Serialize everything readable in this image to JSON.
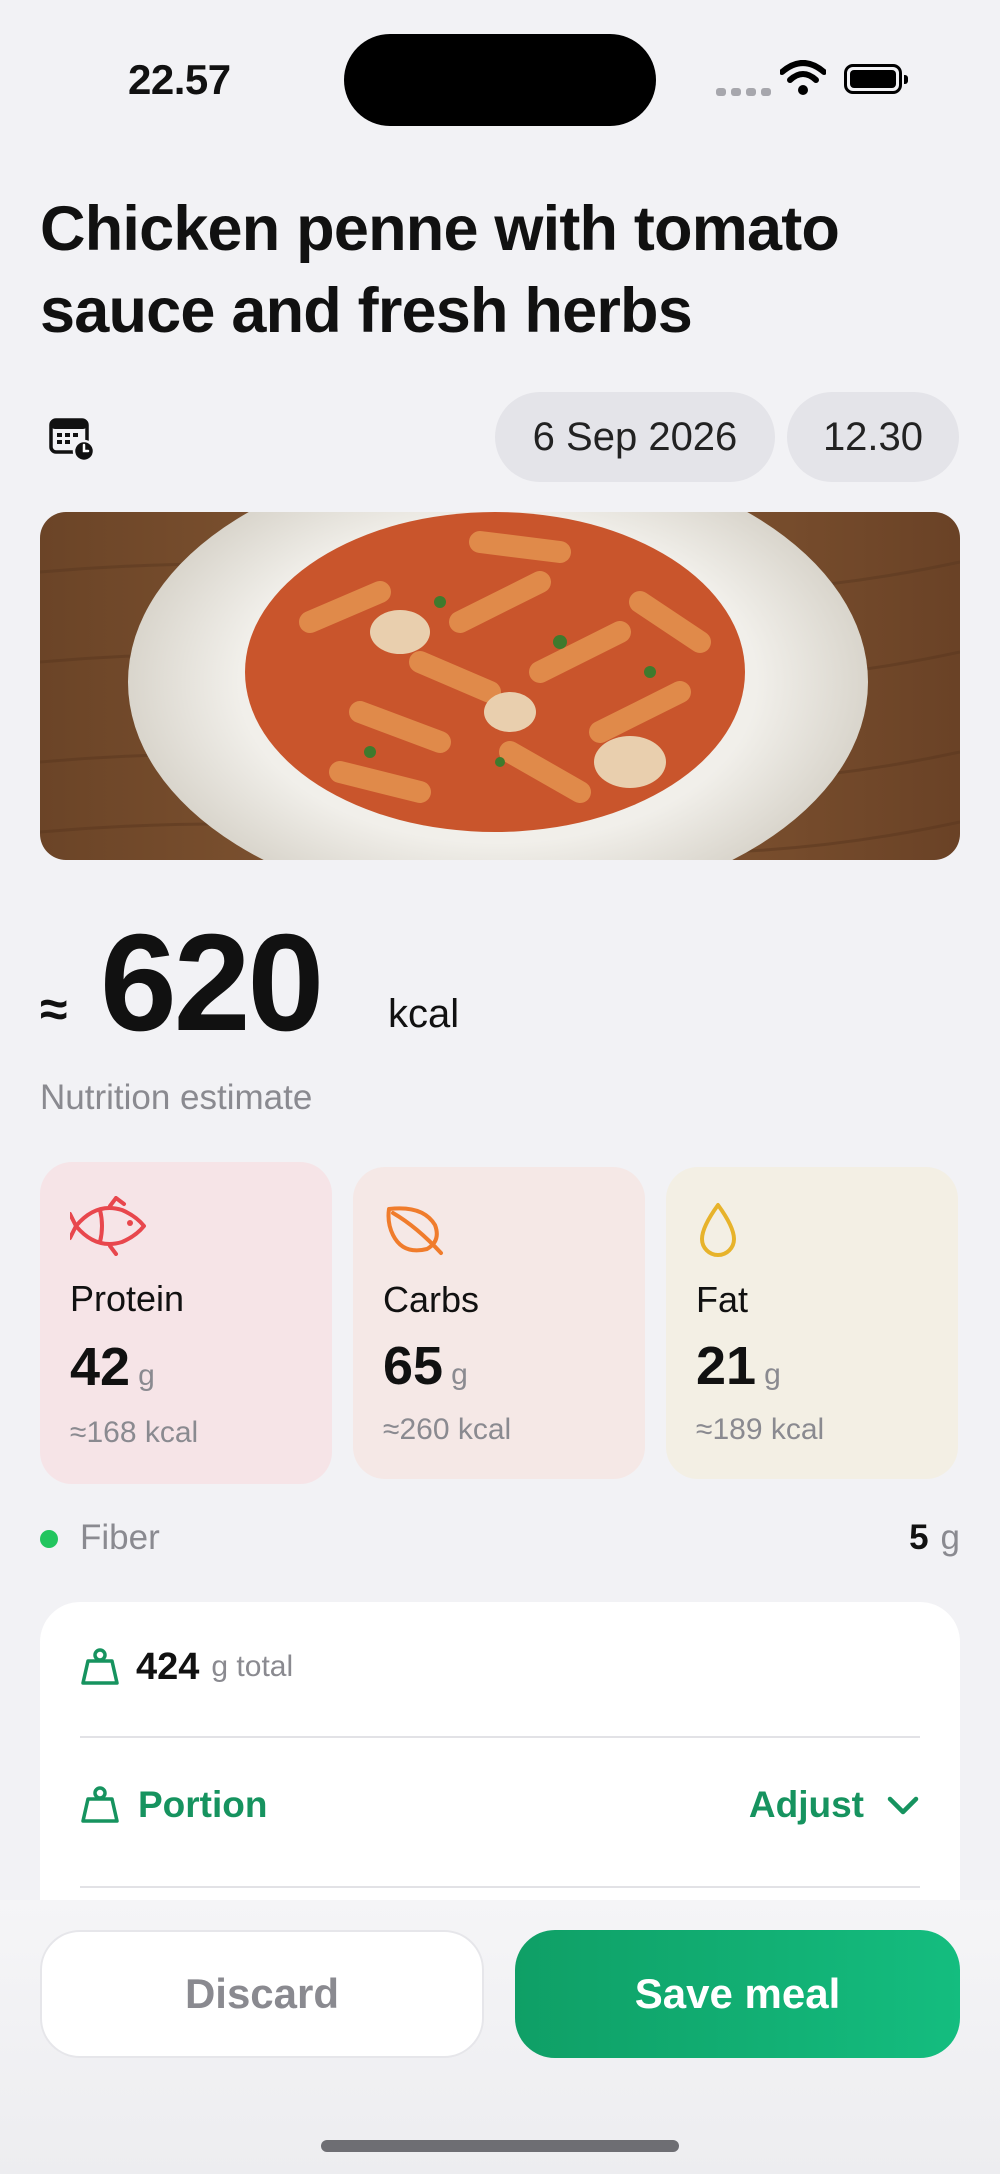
{
  "status_bar": {
    "time": "22.57"
  },
  "meal": {
    "title": "Chicken penne with tomato sauce and fresh herbs",
    "date": "6 Sep 2026",
    "time": "12.30",
    "calendar_icon": "calendar-clock-icon",
    "photo_description_icon": "meal-photo"
  },
  "energy": {
    "approx_symbol": "≈",
    "value": "620",
    "unit": "kcal",
    "label": "Nutrition estimate"
  },
  "macros": [
    {
      "name": "Protein",
      "value": "42",
      "unit": "g",
      "kcal": "≈168 kcal",
      "icon": "fish-icon",
      "color": "#e8474d"
    },
    {
      "name": "Carbs",
      "value": "65",
      "unit": "g",
      "kcal": "≈260 kcal",
      "icon": "leaf-icon",
      "color": "#f07c2c"
    },
    {
      "name": "Fat",
      "value": "21",
      "unit": "g",
      "kcal": "≈189 kcal",
      "icon": "drop-icon",
      "color": "#e7b32b"
    }
  ],
  "fiber": {
    "label": "Fiber",
    "value": "5",
    "unit": "g",
    "dot_color": "#22c55e"
  },
  "weight_card": {
    "total_value": "424",
    "total_label": "g total",
    "portion_label": "Portion",
    "adjust_label": "Adjust"
  },
  "actions": {
    "discard": "Discard",
    "save": "Save meal"
  },
  "colors": {
    "accent_green": "#16935f",
    "background": "#f2f2f5"
  }
}
